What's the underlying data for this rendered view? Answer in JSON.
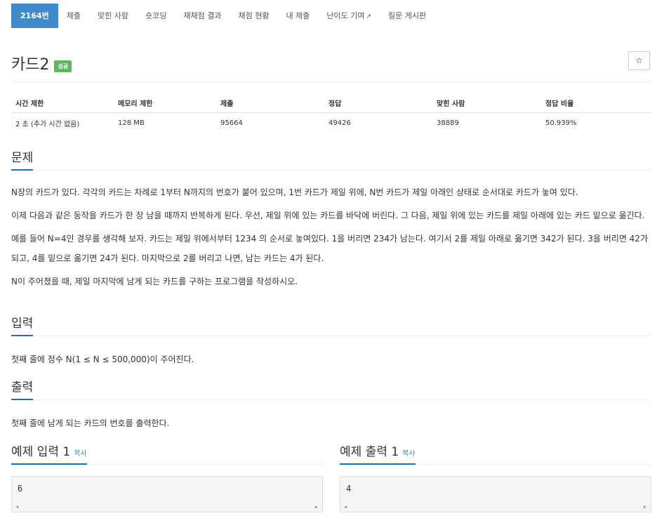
{
  "tabs": [
    {
      "label": "2164번",
      "active": true
    },
    {
      "label": "제출"
    },
    {
      "label": "맞힌 사람"
    },
    {
      "label": "숏코딩"
    },
    {
      "label": "재채점 결과"
    },
    {
      "label": "채점 현황"
    },
    {
      "label": "내 제출"
    },
    {
      "label": "난이도 기여"
    },
    {
      "label": "질문 게시판"
    }
  ],
  "problem": {
    "title": "카드2",
    "badge": "성공",
    "star": "☆"
  },
  "info_table": {
    "headers": [
      "시간 제한",
      "메모리 제한",
      "제출",
      "정답",
      "맞힌 사람",
      "정답 비율"
    ],
    "row": [
      "2 초 (추가 시간 없음)",
      "128 MB",
      "95664",
      "49426",
      "38889",
      "50.939%"
    ]
  },
  "sections": {
    "problem_title": "문제",
    "problem_paras": [
      "N장의 카드가 있다. 각각의 카드는 차례로 1부터 N까지의 번호가 붙어 있으며, 1번 카드가 제일 위에, N번 카드가 제일 아래인 상태로 순서대로 카드가 놓여 있다.",
      "이제 다음과 같은 동작을 카드가 한 장 남을 때까지 반복하게 된다. 우선, 제일 위에 있는 카드를 바닥에 버린다. 그 다음, 제일 위에 있는 카드를 제일 아래에 있는 카드 밑으로 옮긴다.",
      "예를 들어 N=4인 경우를 생각해 보자. 카드는 제일 위에서부터 1234 의 순서로 놓여있다. 1을 버리면 234가 남는다. 여기서 2를 제일 아래로 옮기면 342가 된다. 3을 버리면 42가 되고, 4를 밑으로 옮기면 24가 된다. 마지막으로 2를 버리고 나면, 남는 카드는 4가 된다.",
      "N이 주어졌을 때, 제일 마지막에 남게 되는 카드를 구하는 프로그램을 작성하시오."
    ],
    "input_title": "입력",
    "input_text": "첫째 줄에 정수 N(1 ≤ N ≤ 500,000)이 주어진다.",
    "output_title": "출력",
    "output_text": "첫째 줄에 남게 되는 카드의 번호를 출력한다."
  },
  "samples": {
    "input_title": "예제 입력 1",
    "output_title": "예제 출력 1",
    "copy_label": "복사",
    "input_value": "6",
    "output_value": "4"
  }
}
